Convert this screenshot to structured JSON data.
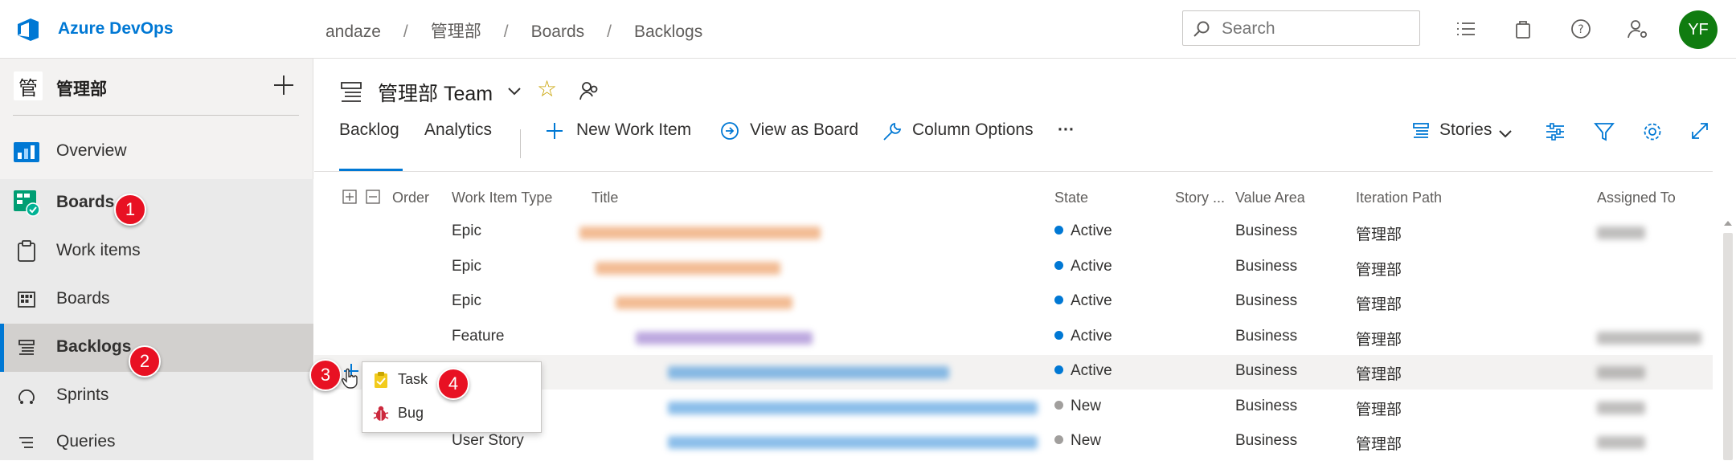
{
  "app": {
    "brand": "Azure DevOps",
    "breadcrumb": [
      "andaze",
      "管理部",
      "Boards",
      "Backlogs"
    ],
    "search_placeholder": "Search",
    "avatar_initials": "YF"
  },
  "sidebar": {
    "project_badge": "管",
    "project_name": "管理部",
    "items": [
      {
        "label": "Overview",
        "icon": "overview-icon"
      },
      {
        "label": "Boards",
        "icon": "boards-hub-icon"
      },
      {
        "label": "Work items",
        "icon": "work-items-icon"
      },
      {
        "label": "Boards",
        "icon": "kanban-board-icon"
      },
      {
        "label": "Backlogs",
        "icon": "backlog-icon",
        "selected": true
      },
      {
        "label": "Sprints",
        "icon": "sprints-icon"
      },
      {
        "label": "Queries",
        "icon": "queries-icon"
      }
    ]
  },
  "callouts": [
    "1",
    "2",
    "3",
    "4"
  ],
  "team": {
    "name": "管理部 Team"
  },
  "tabs": {
    "backlog": "Backlog",
    "analytics": "Analytics"
  },
  "toolbar": {
    "new_work_item": "New Work Item",
    "view_as_board": "View as Board",
    "column_options": "Column Options",
    "more": "···",
    "level": "Stories"
  },
  "table": {
    "columns": [
      "Order",
      "Work Item Type",
      "Title",
      "State",
      "Story ...",
      "Value Area",
      "Iteration Path",
      "Assigned To"
    ],
    "rows": [
      {
        "type": "Epic",
        "state": "Active",
        "state_color": "#0078d4",
        "value_area": "Business",
        "iteration": "管理部"
      },
      {
        "type": "Epic",
        "state": "Active",
        "state_color": "#0078d4",
        "value_area": "Business",
        "iteration": "管理部"
      },
      {
        "type": "Epic",
        "state": "Active",
        "state_color": "#0078d4",
        "value_area": "Business",
        "iteration": "管理部"
      },
      {
        "type": "Feature",
        "state": "Active",
        "state_color": "#0078d4",
        "value_area": "Business",
        "iteration": "管理部"
      },
      {
        "type": "",
        "state": "Active",
        "state_color": "#0078d4",
        "value_area": "Business",
        "iteration": "管理部"
      },
      {
        "type": "",
        "state": "New",
        "state_color": "#a19f9d",
        "value_area": "Business",
        "iteration": "管理部"
      },
      {
        "type": "User Story",
        "state": "New",
        "state_color": "#a19f9d",
        "value_area": "Business",
        "iteration": "管理部"
      }
    ]
  },
  "popup": {
    "items": [
      {
        "label": "Task",
        "icon": "task-icon"
      },
      {
        "label": "Bug",
        "icon": "bug-icon"
      }
    ]
  },
  "colors": {
    "accent": "#0078d4",
    "callout": "#e81123",
    "avatar": "#107c10"
  }
}
